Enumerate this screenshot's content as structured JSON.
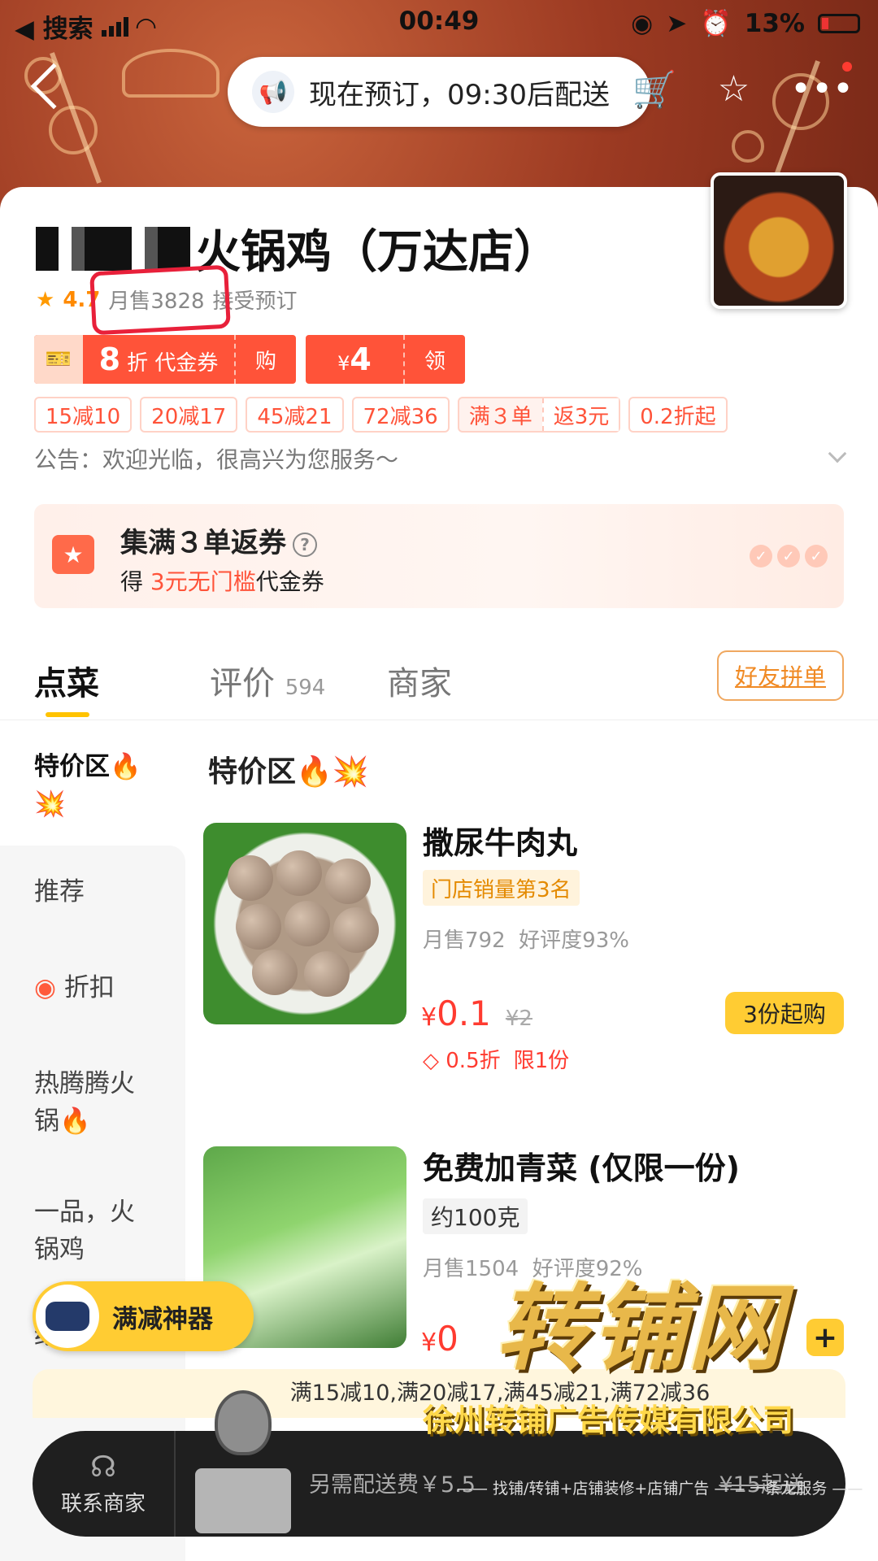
{
  "status_bar": {
    "back_app": "◀ 搜索",
    "time": "00:49",
    "battery": "13%"
  },
  "nav": {
    "reservation_notice": "现在预订，09:30后配送",
    "icons": [
      "back-icon",
      "cart-icon",
      "star-icon",
      "more-icon"
    ]
  },
  "shop": {
    "name": "火锅鸡（万达店）",
    "rating": "4.7",
    "monthly_sales": "月售3828",
    "accept_reservation": "接受预订"
  },
  "coupons": [
    {
      "value": "8",
      "unit": "折 代金券",
      "action": "购"
    },
    {
      "value": "4",
      "currency": "¥",
      "action": "领"
    }
  ],
  "promo_tags": [
    "15减10",
    "20减17",
    "45减21",
    "72减36",
    "满３单",
    "返3元",
    "0.2折起"
  ],
  "notice": "公告：欢迎光临，很高兴为您服务～",
  "collect_banner": {
    "title": "集满３单返券",
    "prefix": "得 ",
    "highlight": "3元无门槛",
    "suffix": "代金券"
  },
  "tabs": {
    "order": "点菜",
    "reviews": "评价",
    "review_count": "594",
    "merchant": "商家",
    "friend_order": "好友拼单"
  },
  "sidebar": {
    "items": [
      "特价区🔥💥",
      "推荐",
      "折扣",
      "热腾腾火锅🔥",
      "一品，火锅鸡",
      "绝"
    ]
  },
  "section": {
    "title": "特价区🔥💥"
  },
  "products": [
    {
      "name": "撒尿牛肉丸",
      "badge": "门店销量第3名",
      "monthly_sales": "月售792",
      "rating": "好评度93%",
      "price": "0.1",
      "original_price": "¥2",
      "discount": "0.5折",
      "limit": "限1份",
      "min_button": "3份起购"
    },
    {
      "name": "免费加青菜 (仅限一份)",
      "badge": "约100克",
      "monthly_sales": "月售1504",
      "rating": "好评度92%",
      "price": "0",
      "add_button": "+"
    }
  ],
  "promo_button": "满减神器",
  "bottom": {
    "full_reduction": "满15减10,满20减17,满45减21,满72减36",
    "contact": "联系商家",
    "delivery_fee": "另需配送费￥5.5",
    "min_order": "¥15起送"
  },
  "watermark": {
    "logo": "转铺网",
    "company": "徐州转铺广告传媒有限公司",
    "services": "—— 找铺/转铺+店铺装修+店铺广告 —— 一条龙服务 ——"
  },
  "colors": {
    "accent_orange": "#ff5339",
    "accent_yellow": "#ffcc33",
    "price_red": "#ff3b30"
  }
}
